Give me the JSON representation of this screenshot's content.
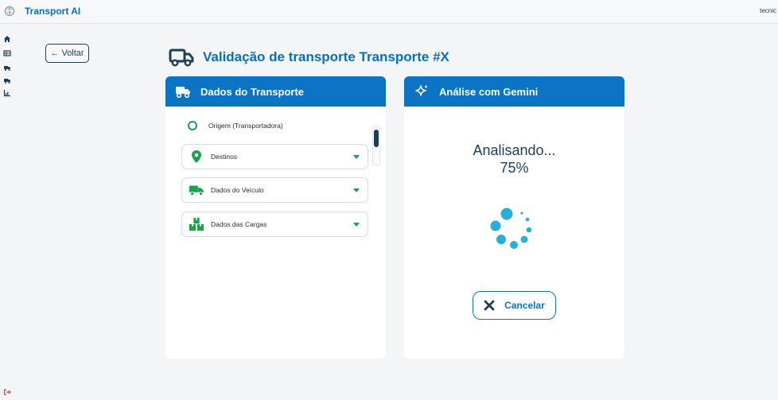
{
  "app": {
    "title": "Transport AI",
    "user": "tecnic"
  },
  "back_button": {
    "label": "← Voltar"
  },
  "page": {
    "title": "Validação de transporte Transporte #X"
  },
  "left_card": {
    "title": "Dados do Transporte",
    "origin_label": "Origem (Transportadora)",
    "sections": [
      {
        "label": "Destinos",
        "icon": "map-pin-icon"
      },
      {
        "label": "Dados do Veículo",
        "icon": "truck-icon"
      },
      {
        "label": "Dados das Cargas",
        "icon": "boxes-icon"
      }
    ]
  },
  "right_card": {
    "title": "Análise com Gemini",
    "status_line1": "Analisando...",
    "status_progress": "75%",
    "progress_fraction": 0.75,
    "cancel_label": "Cancelar"
  },
  "sidebar": {
    "items": [
      "home-icon",
      "table-icon",
      "truck-icon",
      "truck-icon",
      "chart-icon"
    ],
    "bottom": "logout-icon"
  },
  "colors": {
    "primary": "#0b74c4",
    "title_blue": "#0b6fb8",
    "green": "#16a34a",
    "dark": "#1e3e57",
    "spinner": "#26b0d8"
  }
}
